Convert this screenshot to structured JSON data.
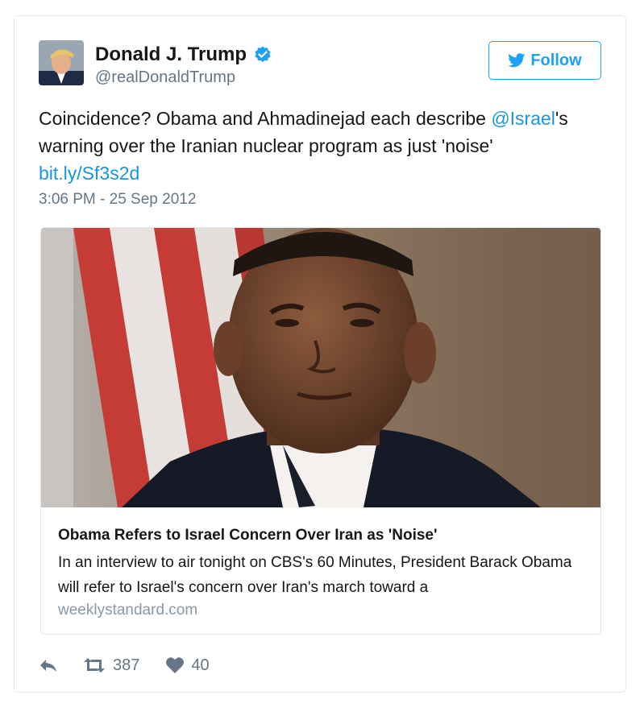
{
  "author": {
    "name": "Donald J. Trump",
    "handle": "@realDonaldTrump"
  },
  "follow_label": "Follow",
  "tweet": {
    "text_part1": "Coincidence? Obama and Ahmadinejad each describe ",
    "mention": "@Israel",
    "text_part2": "'s warning over the Iranian nuclear program as just 'noise'",
    "link": "bit.ly/Sf3s2d",
    "timestamp": "3:06 PM - 25 Sep 2012"
  },
  "card": {
    "title": "Obama Refers to Israel Concern Over Iran as 'Noise'",
    "description": "In an interview to air tonight on CBS's 60 Minutes, President Barack Obama will refer to Israel's concern over Iran's march toward a",
    "domain": "weeklystandard.com"
  },
  "actions": {
    "retweet_count": "387",
    "like_count": "40"
  },
  "colors": {
    "accent": "#1da1f2",
    "link": "#1b95e0",
    "muted": "#657786",
    "text": "#14171a"
  },
  "icons": [
    "verified-badge-icon",
    "twitter-bird-icon",
    "reply-icon",
    "retweet-icon",
    "heart-icon"
  ]
}
